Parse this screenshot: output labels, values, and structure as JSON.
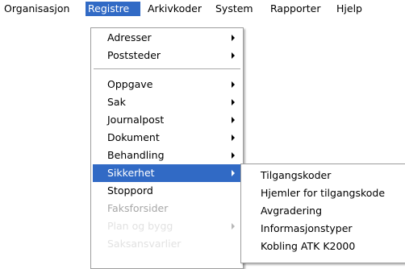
{
  "menubar": {
    "items": [
      {
        "label": "Organisasjon",
        "active": false
      },
      {
        "label": "Registre",
        "active": true
      },
      {
        "label": "Arkivkoder",
        "active": false
      },
      {
        "label": "System",
        "active": false
      },
      {
        "label": "Rapporter",
        "active": false
      },
      {
        "label": "Hjelp",
        "active": false
      }
    ]
  },
  "registre_menu": {
    "items": [
      {
        "label": "Adresser",
        "submenu": true
      },
      {
        "label": "Poststeder",
        "submenu": true
      },
      {
        "separator": true
      },
      {
        "label": "Oppgave",
        "submenu": true
      },
      {
        "label": "Sak",
        "submenu": true
      },
      {
        "label": "Journalpost",
        "submenu": true
      },
      {
        "label": "Dokument",
        "submenu": true
      },
      {
        "label": "Behandling",
        "submenu": true
      },
      {
        "label": "Sikkerhet",
        "submenu": true,
        "highlighted": true
      },
      {
        "label": "Stoppord",
        "submenu": false
      },
      {
        "label": "Faksforsider",
        "submenu": false,
        "disabled": true
      },
      {
        "label": "Plan og bygg",
        "submenu": true,
        "disabled": true
      },
      {
        "label": "Saksansvarlier",
        "submenu": false,
        "disabled": true
      }
    ]
  },
  "sikkerhet_menu": {
    "items": [
      {
        "label": "Tilgangskoder"
      },
      {
        "label": "Hjemler for tilgangskode"
      },
      {
        "label": "Avgradering"
      },
      {
        "label": "Informasjonstyper"
      },
      {
        "label": "Kobling ATK K2000"
      }
    ]
  },
  "colors": {
    "highlight": "#316ac5",
    "disabled_text": "#a7a7a7"
  }
}
